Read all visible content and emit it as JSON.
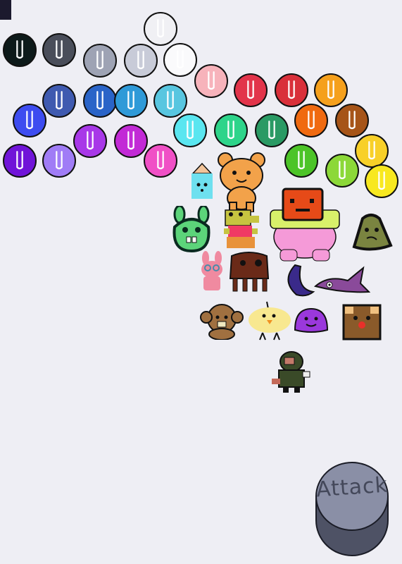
{
  "colors": {
    "background": "#eeeef4",
    "outline": "#111111"
  },
  "balls": [
    {
      "color": "#f0f0f4"
    },
    {
      "color": "#0d1a1a"
    },
    {
      "color": "#4a4e5a"
    },
    {
      "color": "#9ea3b4"
    },
    {
      "color": "#c8cbd8"
    },
    {
      "color": "#fafafc"
    },
    {
      "color": "#f7b3bb"
    },
    {
      "color": "#e2344a"
    },
    {
      "color": "#d9303a"
    },
    {
      "color": "#f5a01c"
    },
    {
      "color": "#3f5ab0"
    },
    {
      "color": "#2a64c8"
    },
    {
      "color": "#2f9ad8"
    },
    {
      "color": "#58c6e0"
    },
    {
      "color": "#5ae6f0"
    },
    {
      "color": "#2ed48a"
    },
    {
      "color": "#2a9a64"
    },
    {
      "color": "#f06a10"
    },
    {
      "color": "#a65418"
    },
    {
      "color": "#3d4cf0"
    },
    {
      "color": "#a838e8"
    },
    {
      "color": "#c22ad6"
    },
    {
      "color": "#f050c6"
    },
    {
      "color": "#4cc428"
    },
    {
      "color": "#8cd838"
    },
    {
      "color": "#f8d028"
    },
    {
      "color": "#f8e820"
    },
    {
      "color": "#7014d8"
    },
    {
      "color": "#a07cf6"
    }
  ],
  "monsters": [
    {
      "name": "cyan-block"
    },
    {
      "name": "orange-bear"
    },
    {
      "name": "green-bunny"
    },
    {
      "name": "yellow-croc"
    },
    {
      "name": "pink-ogre"
    },
    {
      "name": "olive-blob"
    },
    {
      "name": "pink-bunny"
    },
    {
      "name": "brown-box-creature"
    },
    {
      "name": "purple-crescent"
    },
    {
      "name": "purple-fish"
    },
    {
      "name": "brown-fuzzy"
    },
    {
      "name": "yellow-chick"
    },
    {
      "name": "purple-slime"
    },
    {
      "name": "bear-face-block"
    },
    {
      "name": "zombie-kid"
    }
  ],
  "attack_button": {
    "label": "Attack"
  }
}
